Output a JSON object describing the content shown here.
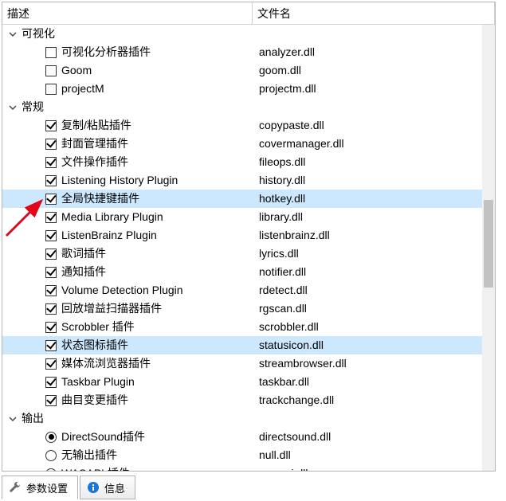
{
  "header": {
    "desc": "描述",
    "file": "文件名"
  },
  "groups": [
    {
      "label": "可视化",
      "expanded": true,
      "items": [
        {
          "type": "checkbox",
          "checked": false,
          "label": "可视化分析器插件",
          "file": "analyzer.dll"
        },
        {
          "type": "checkbox",
          "checked": false,
          "label": "Goom",
          "file": "goom.dll"
        },
        {
          "type": "checkbox",
          "checked": false,
          "label": "projectM",
          "file": "projectm.dll"
        }
      ]
    },
    {
      "label": "常规",
      "expanded": true,
      "items": [
        {
          "type": "checkbox",
          "checked": true,
          "label": "复制/粘贴插件",
          "file": "copypaste.dll"
        },
        {
          "type": "checkbox",
          "checked": true,
          "label": "封面管理插件",
          "file": "covermanager.dll"
        },
        {
          "type": "checkbox",
          "checked": true,
          "label": "文件操作插件",
          "file": "fileops.dll"
        },
        {
          "type": "checkbox",
          "checked": true,
          "label": "Listening History Plugin",
          "file": "history.dll"
        },
        {
          "type": "checkbox",
          "checked": true,
          "label": "全局快捷键插件",
          "file": "hotkey.dll",
          "highlight": true
        },
        {
          "type": "checkbox",
          "checked": true,
          "label": "Media Library Plugin",
          "file": "library.dll"
        },
        {
          "type": "checkbox",
          "checked": true,
          "label": "ListenBrainz Plugin",
          "file": "listenbrainz.dll"
        },
        {
          "type": "checkbox",
          "checked": true,
          "label": "歌词插件",
          "file": "lyrics.dll"
        },
        {
          "type": "checkbox",
          "checked": true,
          "label": "通知插件",
          "file": "notifier.dll"
        },
        {
          "type": "checkbox",
          "checked": true,
          "label": "Volume Detection Plugin",
          "file": "rdetect.dll"
        },
        {
          "type": "checkbox",
          "checked": true,
          "label": "回放增益扫描器插件",
          "file": "rgscan.dll"
        },
        {
          "type": "checkbox",
          "checked": true,
          "label": "Scrobbler 插件",
          "file": "scrobbler.dll"
        },
        {
          "type": "checkbox",
          "checked": true,
          "label": "状态图标插件",
          "file": "statusicon.dll",
          "highlight": true
        },
        {
          "type": "checkbox",
          "checked": true,
          "label": "媒体流浏览器插件",
          "file": "streambrowser.dll"
        },
        {
          "type": "checkbox",
          "checked": true,
          "label": "Taskbar Plugin",
          "file": "taskbar.dll"
        },
        {
          "type": "checkbox",
          "checked": true,
          "label": "曲目变更插件",
          "file": "trackchange.dll"
        }
      ]
    },
    {
      "label": "输出",
      "expanded": true,
      "items": [
        {
          "type": "radio",
          "checked": true,
          "label": "DirectSound插件",
          "file": "directsound.dll"
        },
        {
          "type": "radio",
          "checked": false,
          "label": "无输出插件",
          "file": "null.dll"
        },
        {
          "type": "radio",
          "checked": false,
          "label": "WASAPI 插件",
          "file": "wasapi.dll"
        }
      ]
    }
  ],
  "tabs": {
    "settings": "参数设置",
    "info": "信息"
  }
}
